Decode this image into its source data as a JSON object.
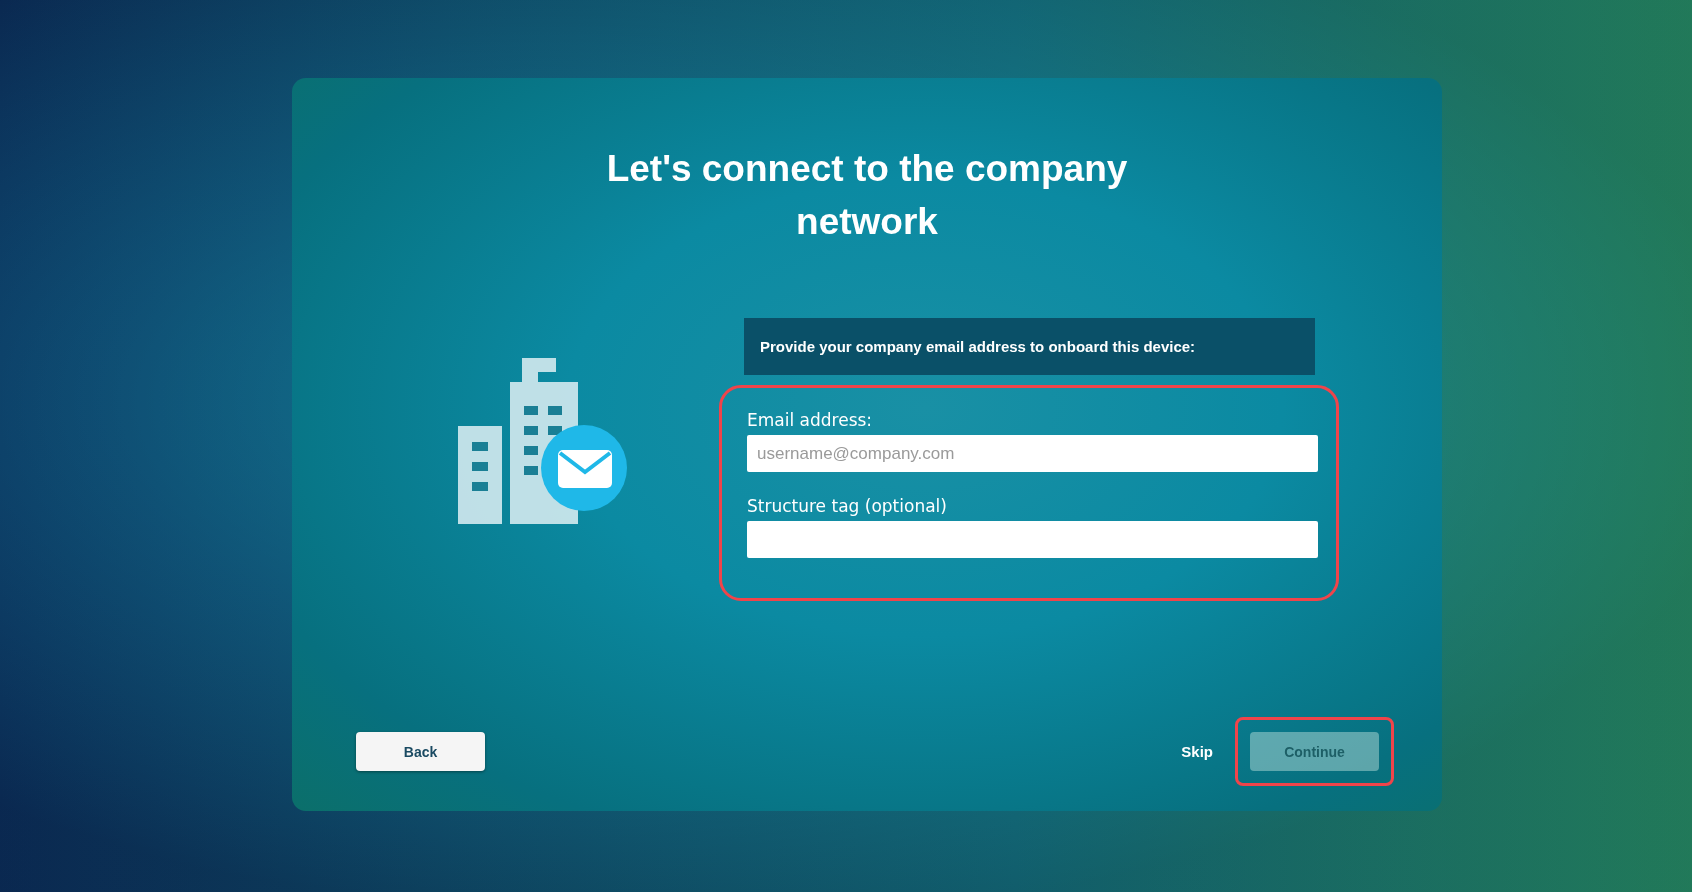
{
  "title": "Let's connect to the company network",
  "instruction": "Provide your company email address to onboard this device:",
  "field_group": {
    "highlighted": true
  },
  "fields": [
    {
      "label": "Email address:",
      "placeholder": "username@company.com"
    },
    {
      "label": "Structure tag (optional)"
    }
  ],
  "buttons": [
    {
      "kind": "secondary",
      "label": "Back",
      "disabled": false
    },
    {
      "kind": "link",
      "label": "Skip",
      "disabled": false
    },
    {
      "kind": "primary",
      "label": "Continue",
      "disabled": true,
      "highlighted": true
    }
  ]
}
